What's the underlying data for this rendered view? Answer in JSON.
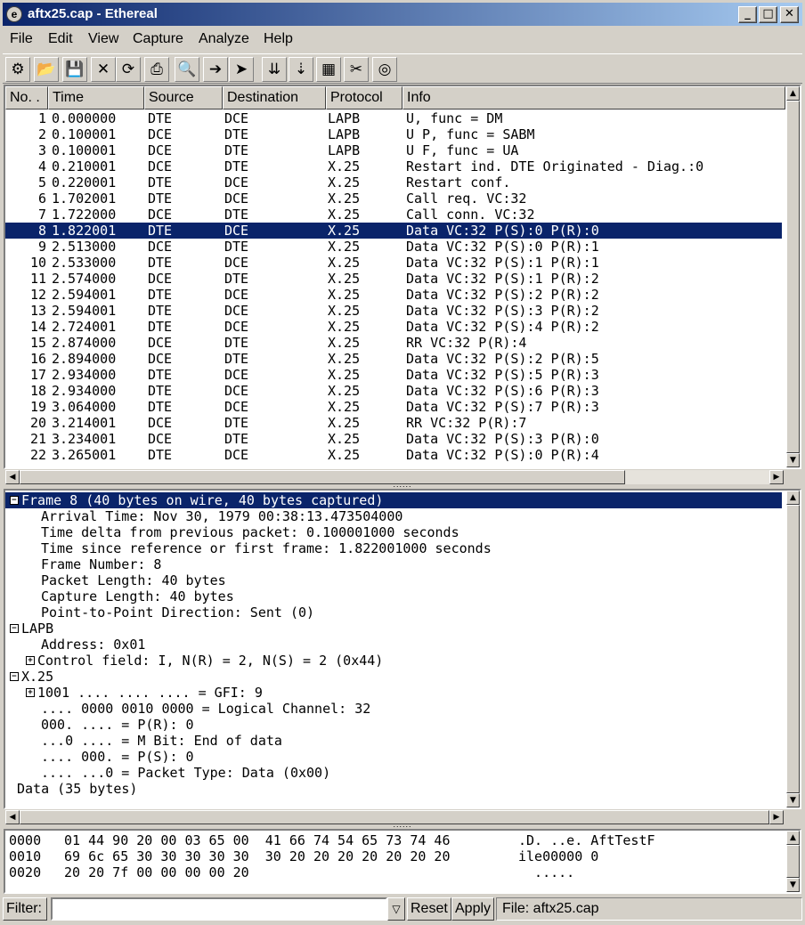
{
  "window": {
    "title": "aftx25.cap - Ethereal",
    "app_icon_glyph": "e"
  },
  "menu": [
    "File",
    "Edit",
    "View",
    "Capture",
    "Analyze",
    "Help"
  ],
  "toolbar": [
    {
      "name": "capture-options-icon",
      "glyph": "⚙"
    },
    {
      "name": "open-icon",
      "glyph": "📂"
    },
    {
      "name": "save-icon",
      "glyph": "💾"
    },
    {
      "name": "close-icon",
      "glyph": "✕"
    },
    {
      "name": "reload-icon",
      "glyph": "⟳"
    },
    {
      "name": "print-icon",
      "glyph": "⎙"
    },
    {
      "name": "find-icon",
      "glyph": "🔍"
    },
    {
      "name": "go-to-icon",
      "glyph": "➔"
    },
    {
      "name": "go-to-packet-icon",
      "glyph": "➤"
    },
    {
      "name": "capture-filter-icon",
      "glyph": "⇊"
    },
    {
      "name": "display-filter-icon",
      "glyph": "⇣"
    },
    {
      "name": "coloring-icon",
      "glyph": "▦"
    },
    {
      "name": "preferences-icon",
      "glyph": "✂"
    },
    {
      "name": "help-icon",
      "glyph": "◎"
    }
  ],
  "packet_list": {
    "columns": [
      "No. .",
      "Time",
      "Source",
      "Destination",
      "Protocol",
      "Info"
    ],
    "rows": [
      [
        "1",
        "0.000000",
        "DTE",
        "DCE",
        "LAPB",
        "U, func = DM"
      ],
      [
        "2",
        "0.100001",
        "DCE",
        "DTE",
        "LAPB",
        "U P, func = SABM"
      ],
      [
        "3",
        "0.100001",
        "DCE",
        "DTE",
        "LAPB",
        "U F, func = UA"
      ],
      [
        "4",
        "0.210001",
        "DCE",
        "DTE",
        "X.25",
        "Restart ind. DTE Originated - Diag.:0"
      ],
      [
        "5",
        "0.220001",
        "DTE",
        "DCE",
        "X.25",
        "Restart conf."
      ],
      [
        "6",
        "1.702001",
        "DTE",
        "DCE",
        "X.25",
        "Call req. VC:32"
      ],
      [
        "7",
        "1.722000",
        "DCE",
        "DTE",
        "X.25",
        "Call conn. VC:32"
      ],
      [
        "8",
        "1.822001",
        "DTE",
        "DCE",
        "X.25",
        "Data VC:32 P(S):0 P(R):0"
      ],
      [
        "9",
        "2.513000",
        "DCE",
        "DTE",
        "X.25",
        "Data VC:32 P(S):0 P(R):1"
      ],
      [
        "10",
        "2.533000",
        "DTE",
        "DCE",
        "X.25",
        "Data VC:32 P(S):1 P(R):1"
      ],
      [
        "11",
        "2.574000",
        "DCE",
        "DTE",
        "X.25",
        "Data VC:32 P(S):1 P(R):2"
      ],
      [
        "12",
        "2.594001",
        "DTE",
        "DCE",
        "X.25",
        "Data VC:32 P(S):2 P(R):2"
      ],
      [
        "13",
        "2.594001",
        "DTE",
        "DCE",
        "X.25",
        "Data VC:32 P(S):3 P(R):2"
      ],
      [
        "14",
        "2.724001",
        "DTE",
        "DCE",
        "X.25",
        "Data VC:32 P(S):4 P(R):2"
      ],
      [
        "15",
        "2.874000",
        "DCE",
        "DTE",
        "X.25",
        "RR VC:32 P(R):4"
      ],
      [
        "16",
        "2.894000",
        "DCE",
        "DTE",
        "X.25",
        "Data VC:32 P(S):2 P(R):5"
      ],
      [
        "17",
        "2.934000",
        "DTE",
        "DCE",
        "X.25",
        "Data VC:32 P(S):5 P(R):3"
      ],
      [
        "18",
        "2.934000",
        "DTE",
        "DCE",
        "X.25",
        "Data VC:32 P(S):6 P(R):3"
      ],
      [
        "19",
        "3.064000",
        "DTE",
        "DCE",
        "X.25",
        "Data VC:32 P(S):7 P(R):3"
      ],
      [
        "20",
        "3.214001",
        "DCE",
        "DTE",
        "X.25",
        "RR VC:32 P(R):7"
      ],
      [
        "21",
        "3.234001",
        "DCE",
        "DTE",
        "X.25",
        "Data VC:32 P(S):3 P(R):0"
      ],
      [
        "22",
        "3.265001",
        "DTE",
        "DCE",
        "X.25",
        "Data VC:32 P(S):0 P(R):4"
      ]
    ],
    "selected_index": 7
  },
  "detail": {
    "lines": [
      {
        "indent": 0,
        "expander": "-",
        "text": "Frame 8 (40 bytes on wire, 40 bytes captured)",
        "selected": true
      },
      {
        "indent": 2,
        "expander": "",
        "text": "Arrival Time: Nov 30, 1979 00:38:13.473504000"
      },
      {
        "indent": 2,
        "expander": "",
        "text": "Time delta from previous packet: 0.100001000 seconds"
      },
      {
        "indent": 2,
        "expander": "",
        "text": "Time since reference or first frame: 1.822001000 seconds"
      },
      {
        "indent": 2,
        "expander": "",
        "text": "Frame Number: 8"
      },
      {
        "indent": 2,
        "expander": "",
        "text": "Packet Length: 40 bytes"
      },
      {
        "indent": 2,
        "expander": "",
        "text": "Capture Length: 40 bytes"
      },
      {
        "indent": 2,
        "expander": "",
        "text": "Point-to-Point Direction: Sent (0)"
      },
      {
        "indent": 0,
        "expander": "-",
        "text": "LAPB"
      },
      {
        "indent": 2,
        "expander": "",
        "text": "Address: 0x01"
      },
      {
        "indent": 1,
        "expander": "+",
        "text": "Control field: I, N(R) = 2, N(S) = 2 (0x44)"
      },
      {
        "indent": 0,
        "expander": "-",
        "text": "X.25"
      },
      {
        "indent": 1,
        "expander": "+",
        "text": "1001 .... .... .... = GFI: 9"
      },
      {
        "indent": 2,
        "expander": "",
        "text": ".... 0000 0010 0000 = Logical Channel: 32"
      },
      {
        "indent": 2,
        "expander": "",
        "text": "000. .... = P(R): 0"
      },
      {
        "indent": 2,
        "expander": "",
        "text": "...0 .... = M Bit: End of data"
      },
      {
        "indent": 2,
        "expander": "",
        "text": ".... 000. = P(S): 0"
      },
      {
        "indent": 2,
        "expander": "",
        "text": ".... ...0 = Packet Type: Data (0x00)"
      },
      {
        "indent": 0.5,
        "expander": "",
        "text": "Data (35 bytes)"
      }
    ]
  },
  "hex": {
    "rows": [
      {
        "offset": "0000",
        "bytes": "01 44 90 20 00 03 65 00  41 66 74 54 65 73 74 46",
        "ascii": ".D. ..e. AftTestF"
      },
      {
        "offset": "0010",
        "bytes": "69 6c 65 30 30 30 30 30  30 20 20 20 20 20 20 20",
        "ascii": "ile00000 0"
      },
      {
        "offset": "0020",
        "bytes": "20 20 7f 00 00 00 00 20",
        "ascii": "  .....  "
      }
    ]
  },
  "filter": {
    "label": "Filter:",
    "value": "",
    "reset_label": "Reset",
    "apply_label": "Apply",
    "status": "File: aftx25.cap"
  }
}
